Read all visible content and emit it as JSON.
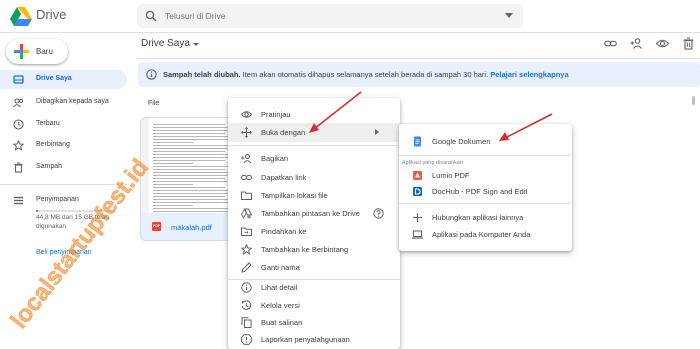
{
  "app": {
    "name": "Drive",
    "colors": {
      "blue": "#1a73e8",
      "accent_bg": "#e8f0fe",
      "arrow": "#d32f2f",
      "watermark": "#f57c00"
    }
  },
  "search": {
    "placeholder": "Telusuri di Drive"
  },
  "sidebar": {
    "new_label": "Baru",
    "items": [
      {
        "label": "Drive Saya",
        "icon": "my-drive-icon",
        "active": true
      },
      {
        "label": "Dibagikan kepada saya",
        "icon": "shared-icon"
      },
      {
        "label": "Terbaru",
        "icon": "clock-icon"
      },
      {
        "label": "Berbintang",
        "icon": "star-icon"
      },
      {
        "label": "Sampah",
        "icon": "trash-icon"
      }
    ],
    "storage": {
      "label": "Penyimpanan",
      "usage": "44,8 MB dari 15 GB telah digunakan",
      "used_fraction": 0.003,
      "buy_label": "Beli penyimpanan"
    }
  },
  "main": {
    "title": "Drive Saya",
    "toolbar_icons": [
      "link-icon",
      "add-person-icon",
      "preview-eye-icon",
      "delete-icon"
    ],
    "banner": {
      "bold": "Sampah telah diubah.",
      "text": " Item akan otomatis dihapus selamanya setelah berada di sampah 30 hari. ",
      "link": "Pelajari selengkapnya"
    },
    "section_label": "File",
    "file": {
      "name": "makalah.pdf",
      "type_badge": "PDF"
    }
  },
  "context_menu": {
    "items": [
      {
        "label": "Pratinjau",
        "icon": "eye-icon"
      },
      {
        "label": "Buka dengan",
        "icon": "open-with-icon",
        "submenu": true,
        "hover": true
      },
      {
        "label": "Bagikan",
        "icon": "add-person-icon"
      },
      {
        "label": "Dapatkan link",
        "icon": "link-icon"
      },
      {
        "label": "Tampilkan lokasi file",
        "icon": "folder-icon"
      },
      {
        "label": "Tambahkan pintasan ke Drive",
        "icon": "drive-shortcut-icon",
        "help": true
      },
      {
        "label": "Pindahkan ke",
        "icon": "move-to-icon"
      },
      {
        "label": "Tambahkan ke Berbintang",
        "icon": "star-icon"
      },
      {
        "label": "Ganti nama",
        "icon": "pencil-icon"
      },
      {
        "label": "Lihat detail",
        "icon": "info-icon"
      },
      {
        "label": "Kelola versi",
        "icon": "versions-icon"
      },
      {
        "label": "Buat salinan",
        "icon": "copy-icon"
      },
      {
        "label": "Laporkan penyalahgunaan",
        "icon": "report-icon"
      }
    ]
  },
  "open_with_menu": {
    "top": {
      "label": "Google Dokumen",
      "icon": "google-docs-icon"
    },
    "section_label": "Aplikasi yang disarankan",
    "suggested": [
      {
        "label": "Lumin PDF",
        "icon": "lumin-pdf-icon"
      },
      {
        "label": "DocHub - PDF Sign and Edit",
        "icon": "dochub-icon"
      }
    ],
    "more": [
      {
        "label": "Hubungkan aplikasi lainnya",
        "icon": "plus-icon"
      },
      {
        "label": "Aplikasi pada Komputer Anda",
        "icon": "computer-icon"
      }
    ]
  },
  "watermark": {
    "text": "localstartupfest.id"
  }
}
